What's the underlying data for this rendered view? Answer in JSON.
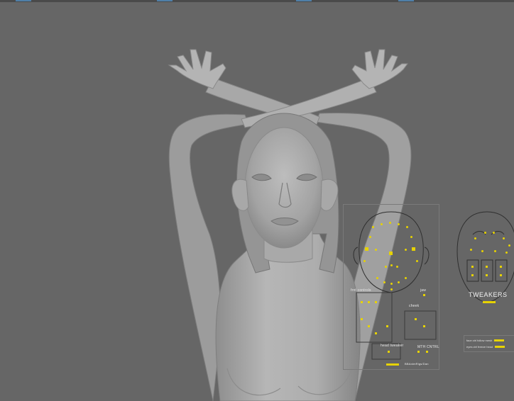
{
  "viewport": {
    "background": "#666666",
    "toolbar_accent": "#4f7fa8"
  },
  "face_rig_panel": {
    "label_fr_controls": "frnt controls",
    "label_jaw": "jaw",
    "label_cheek": "cheek",
    "label_head_tweaker": "head tweaker",
    "label_mth_cntrl": "MTH CNTRL",
    "label_credit": "BBAnimRigs/Dan",
    "accent": "#e6d200"
  },
  "tweakers_panel": {
    "title": "TWEAKERS",
    "legend_follow": "face ctrl follow mesh",
    "legend_freeze": "eyes ctrl freeze head"
  }
}
